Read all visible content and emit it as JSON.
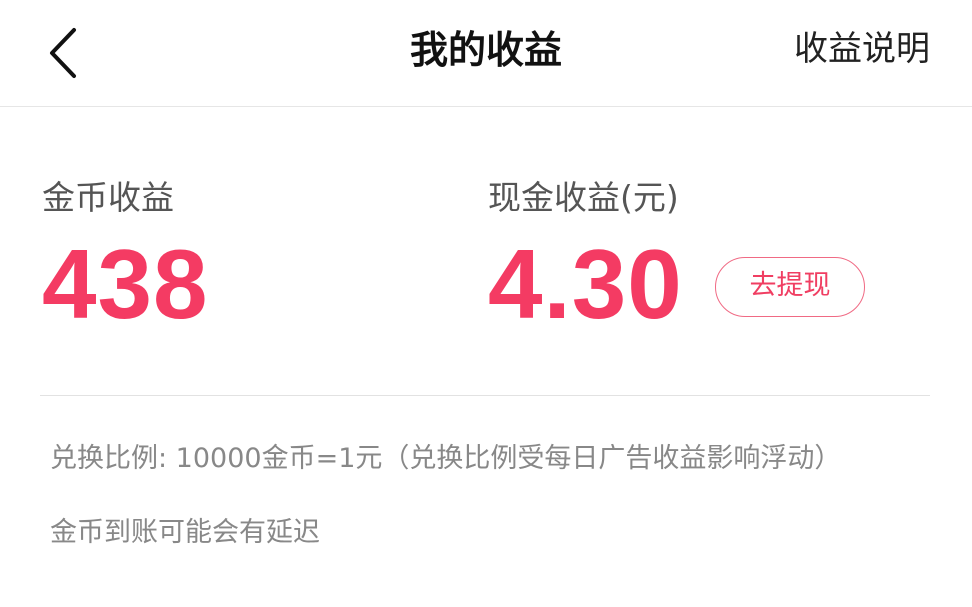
{
  "header": {
    "back_icon": "chevron-left-icon",
    "title": "我的收益",
    "help_link": "收益说明"
  },
  "earnings": {
    "coins": {
      "label": "金币收益",
      "value": "438"
    },
    "cash": {
      "label": "现金收益(元)",
      "value": "4.30",
      "withdraw_label": "去提现"
    },
    "accent_color": "#f43b63"
  },
  "notes": {
    "exchange_rate": "兑换比例: 10000金币=1元（兑换比例受每日广告收益影响浮动）",
    "delay": "金币到账可能会有延迟"
  }
}
